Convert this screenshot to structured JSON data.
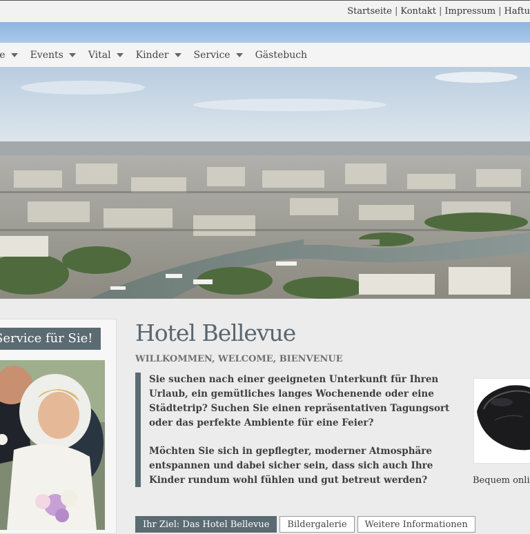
{
  "topbar": {
    "links": [
      "Startseite",
      "Kontakt",
      "Impressum",
      "Haftu"
    ],
    "separator": "|"
  },
  "nav": {
    "items": [
      {
        "label": "me",
        "has_dropdown": true
      },
      {
        "label": "Events",
        "has_dropdown": true
      },
      {
        "label": "Vital",
        "has_dropdown": true
      },
      {
        "label": "Kinder",
        "has_dropdown": true
      },
      {
        "label": "Service",
        "has_dropdown": true
      },
      {
        "label": "Gästebuch",
        "has_dropdown": false
      }
    ]
  },
  "sidebar": {
    "heading": "Service für Sie!"
  },
  "main": {
    "title": "Hotel Bellevue",
    "subtitle": "WILLKOMMEN, WELCOME, BIENVENUE",
    "paragraph1": "Sie suchen nach einer geeigneten Unterkunft für Ihren Urlaub, ein gemütliches langes Wochenende oder eine Städtetrip? Suchen Sie einen repräsentativen Tagungsort oder das perfekte Ambiente für eine Feier?",
    "paragraph2": "Möchten Sie sich in gepflegter, moderner Atmosphäre entspannen und dabei sicher sein, dass sich auch Ihre Kinder rundum wohl fühlen und gut betreut werden?",
    "tabs": [
      {
        "label": "Ihr Ziel: Das Hotel Bellevue",
        "active": true
      },
      {
        "label": "Bildergalerie",
        "active": false
      },
      {
        "label": "Weitere Informationen",
        "active": false
      }
    ]
  },
  "aside": {
    "caption": "Bequem onlin"
  },
  "colors": {
    "accent": "#5b6b72",
    "background": "#ececec"
  }
}
